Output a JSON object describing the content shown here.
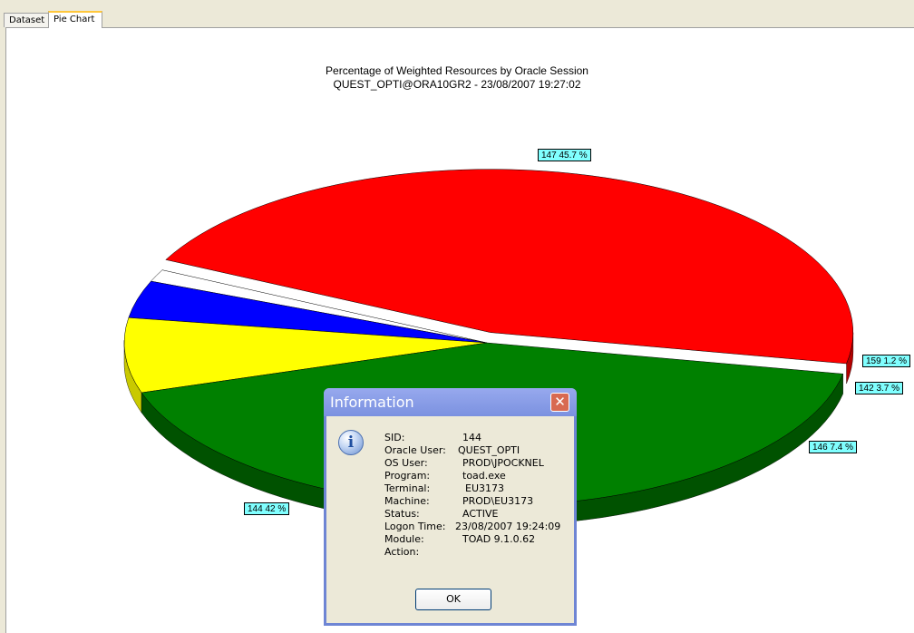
{
  "tabs": [
    {
      "label": "Dataset",
      "active": false
    },
    {
      "label": "Pie Chart",
      "active": true
    }
  ],
  "chart_data": {
    "type": "pie",
    "title": "Percentage of Weighted Resources by Oracle Session",
    "subtitle": "QUEST_OPTI@ORA10GR2 - 23/08/2007 19:27:02",
    "slices": [
      {
        "label": "147 45.7 %",
        "session": "147",
        "percent": 45.7,
        "color": "#ff0000"
      },
      {
        "label": "159 1.2 %",
        "session": "159",
        "percent": 1.2,
        "color": "#ffffff"
      },
      {
        "label": "142 3.7 %",
        "session": "142",
        "percent": 3.7,
        "color": "#0000ff"
      },
      {
        "label": "146 7.4 %",
        "session": "146",
        "percent": 7.4,
        "color": "#ffff00"
      },
      {
        "label": "144 42 %",
        "session": "144",
        "percent": 42,
        "color": "#008000"
      }
    ],
    "style": "3d",
    "exploded": "147"
  },
  "dialog": {
    "title": "Information",
    "icon": "info-icon",
    "fields": [
      {
        "key": "SID:",
        "value": "144"
      },
      {
        "key": "Oracle User:",
        "value": "QUEST_OPTI"
      },
      {
        "key": "OS User:",
        "value": "PROD\\JPOCKNEL"
      },
      {
        "key": "Program:",
        "value": "toad.exe"
      },
      {
        "key": "Terminal:",
        "value": "EU3173"
      },
      {
        "key": "Machine:",
        "value": "PROD\\EU3173"
      },
      {
        "key": "Status:",
        "value": "ACTIVE"
      },
      {
        "key": "Logon Time:",
        "value": "23/08/2007 19:24:09"
      },
      {
        "key": "Module:",
        "value": "TOAD 9.1.0.62"
      },
      {
        "key": "Action:",
        "value": ""
      }
    ],
    "ok_label": "OK",
    "close_symbol": "✕"
  }
}
